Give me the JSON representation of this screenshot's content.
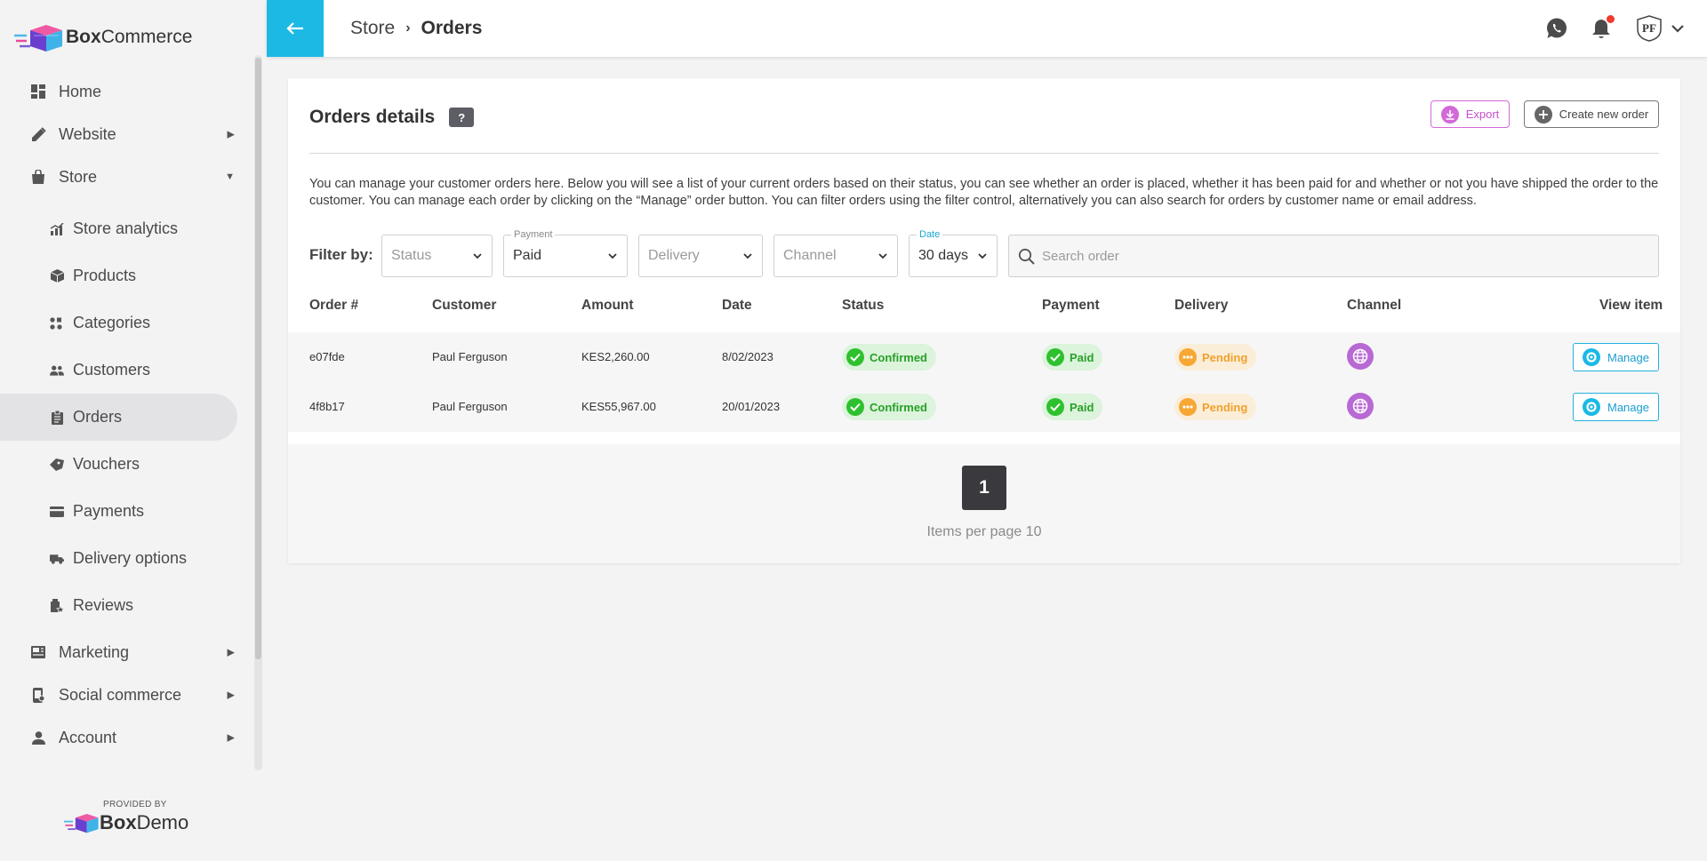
{
  "brand": {
    "name_bold": "Box",
    "name_rest": "Commerce"
  },
  "sidebar": {
    "items": [
      {
        "label": "Home",
        "icon": "dashboard-icon"
      },
      {
        "label": "Website",
        "icon": "pencil-icon",
        "caret": "▶"
      },
      {
        "label": "Store",
        "icon": "shopping-bag-icon",
        "caret": "▼"
      }
    ],
    "store_sub": [
      {
        "label": "Store analytics",
        "icon": "analytics-icon"
      },
      {
        "label": "Products",
        "icon": "box-icon"
      },
      {
        "label": "Categories",
        "icon": "categories-icon"
      },
      {
        "label": "Customers",
        "icon": "people-icon"
      },
      {
        "label": "Orders",
        "icon": "clipboard-icon"
      },
      {
        "label": "Vouchers",
        "icon": "ticket-icon"
      },
      {
        "label": "Payments",
        "icon": "credit-card-icon"
      },
      {
        "label": "Delivery options",
        "icon": "truck-icon"
      },
      {
        "label": "Reviews",
        "icon": "review-icon"
      }
    ],
    "bottom_items": [
      {
        "label": "Marketing",
        "icon": "newspaper-icon",
        "caret": "▶"
      },
      {
        "label": "Social commerce",
        "icon": "phone-icon",
        "caret": "▶"
      },
      {
        "label": "Account",
        "icon": "person-icon",
        "caret": "▶"
      }
    ],
    "provided_by": "PROVIDED BY",
    "provider_bold": "Box",
    "provider_rest": "Demo"
  },
  "header": {
    "crumb_parent": "Store",
    "crumb_sep": "›",
    "crumb_current": "Orders",
    "avatar_initials": "PF"
  },
  "card": {
    "title": "Orders details",
    "help": "?",
    "export_label": "Export",
    "create_label": "Create new order",
    "description": "You can manage your customer orders here. Below you will see a list of your current orders based on their status, you can see whether an order is placed, whether it has been paid for and whether or not you have shipped the order to the customer. You can manage each order by clicking on the “Manage” order button. You can filter orders using the filter control, alternatively you can also search for orders by customer name or email address."
  },
  "filters": {
    "label": "Filter by:",
    "status_placeholder": "Status",
    "payment_label": "Payment",
    "payment_value": "Paid",
    "delivery_placeholder": "Delivery",
    "channel_placeholder": "Channel",
    "date_label": "Date",
    "date_value": "30 days",
    "search_placeholder": "Search order"
  },
  "table": {
    "headers": [
      "Order #",
      "Customer",
      "Amount",
      "Date",
      "Status",
      "Payment",
      "Delivery",
      "Channel",
      "View item"
    ],
    "rows": [
      {
        "order": "e07fde",
        "customer": "Paul Ferguson",
        "amount": "KES2,260.00",
        "date": "8/02/2023",
        "status": "Confirmed",
        "payment": "Paid",
        "delivery": "Pending",
        "channel_icon": "globe-icon",
        "action": "Manage"
      },
      {
        "order": "4f8b17",
        "customer": "Paul Ferguson",
        "amount": "KES55,967.00",
        "date": "20/01/2023",
        "status": "Confirmed",
        "payment": "Paid",
        "delivery": "Pending",
        "channel_icon": "globe-icon",
        "action": "Manage"
      }
    ]
  },
  "pagination": {
    "page": "1",
    "per_page": "Items per page 10"
  },
  "colors": {
    "accent": "#1bb9e4",
    "export": "#c451cc",
    "confirmed": "#2ec12e",
    "pending": "#f7a733",
    "channel": "#b869d4"
  }
}
